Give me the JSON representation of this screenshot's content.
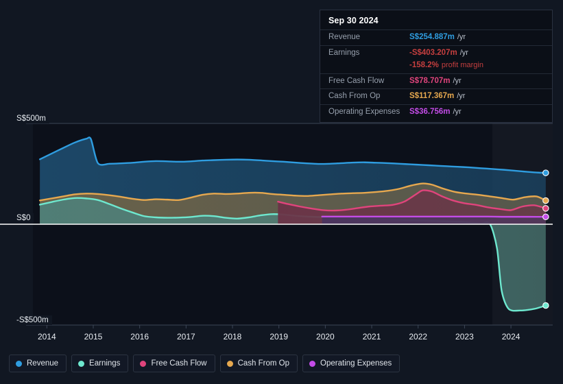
{
  "tooltip": {
    "date": "Sep 30 2024",
    "rows": [
      {
        "label": "Revenue",
        "value": "S$254.887m",
        "unit": "/yr",
        "color": "#2f9de0"
      },
      {
        "label": "Earnings",
        "value": "-S$403.207m",
        "unit": "/yr",
        "color": "#c63f3f"
      },
      {
        "label": "Free Cash Flow",
        "value": "S$78.707m",
        "unit": "/yr",
        "color": "#e0447c"
      },
      {
        "label": "Cash From Op",
        "value": "S$117.367m",
        "unit": "/yr",
        "color": "#e6a84f"
      },
      {
        "label": "Operating Expenses",
        "value": "S$36.756m",
        "unit": "/yr",
        "color": "#c44ce8"
      }
    ],
    "profit_margin": {
      "value": "-158.2%",
      "unit": "profit margin",
      "color": "#c63f3f"
    }
  },
  "legend": {
    "items": [
      {
        "label": "Revenue",
        "color": "#2f9de0"
      },
      {
        "label": "Earnings",
        "color": "#6ee8cf"
      },
      {
        "label": "Free Cash Flow",
        "color": "#e0447c"
      },
      {
        "label": "Cash From Op",
        "color": "#e6a84f"
      },
      {
        "label": "Operating Expenses",
        "color": "#c44ce8"
      }
    ]
  },
  "chart_data": {
    "type": "area",
    "title": "",
    "xlabel": "",
    "ylabel": "",
    "currency": "S$",
    "units": "millions",
    "xlim": [
      2013.7,
      2024.9
    ],
    "ylim": [
      -560,
      560
    ],
    "grid": true,
    "legend_position": "bottom",
    "y_ticks": [
      {
        "value": 500,
        "label": "S$500m"
      },
      {
        "value": 0,
        "label": "S$0"
      },
      {
        "value": -500,
        "label": "-S$500m"
      }
    ],
    "x_ticks": [
      {
        "value": 2014,
        "label": "2014"
      },
      {
        "value": 2015,
        "label": "2015"
      },
      {
        "value": 2016,
        "label": "2016"
      },
      {
        "value": 2017,
        "label": "2017"
      },
      {
        "value": 2018,
        "label": "2018"
      },
      {
        "value": 2019,
        "label": "2019"
      },
      {
        "value": 2020,
        "label": "2020"
      },
      {
        "value": 2021,
        "label": "2021"
      },
      {
        "value": 2022,
        "label": "2022"
      },
      {
        "value": 2023,
        "label": "2023"
      },
      {
        "value": 2024,
        "label": "2024"
      }
    ],
    "highlight_band": {
      "from": 2023.6,
      "to": 2024.9
    },
    "series": [
      {
        "name": "Revenue",
        "color": "#2f9de0",
        "fill": "#1d4a6b",
        "x": [
          2013.85,
          2014.1,
          2014.35,
          2014.6,
          2014.85,
          2014.95,
          2015.1,
          2015.35,
          2015.6,
          2015.85,
          2016.1,
          2016.35,
          2016.6,
          2016.85,
          2017.1,
          2017.35,
          2017.6,
          2017.85,
          2018.1,
          2018.35,
          2018.6,
          2018.85,
          2019.1,
          2019.35,
          2019.6,
          2019.85,
          2020.1,
          2020.35,
          2020.6,
          2020.85,
          2021.1,
          2021.35,
          2021.6,
          2021.85,
          2022.1,
          2022.35,
          2022.6,
          2022.85,
          2023.1,
          2023.35,
          2023.6,
          2023.85,
          2024.1,
          2024.35,
          2024.6,
          2024.75
        ],
        "y": [
          322,
          350,
          378,
          405,
          424,
          422,
          303,
          300,
          302,
          305,
          310,
          313,
          312,
          310,
          312,
          316,
          318,
          320,
          321,
          320,
          317,
          313,
          310,
          306,
          302,
          299,
          300,
          303,
          306,
          307,
          305,
          303,
          300,
          297,
          294,
          291,
          288,
          285,
          282,
          278,
          274,
          270,
          265,
          260,
          256,
          254.887
        ]
      },
      {
        "name": "Earnings",
        "color": "#6ee8cf",
        "fill": "#4f7f78",
        "x": [
          2013.85,
          2014.1,
          2014.35,
          2014.6,
          2014.85,
          2015.1,
          2015.35,
          2015.6,
          2015.85,
          2016.1,
          2016.35,
          2016.6,
          2016.85,
          2017.1,
          2017.35,
          2017.6,
          2017.85,
          2018.1,
          2018.35,
          2018.6,
          2018.85,
          2019.1,
          2019.35,
          2019.6,
          2019.85,
          2020.1,
          2020.35,
          2020.6,
          2020.85,
          2021.1,
          2021.35,
          2021.6,
          2021.85,
          2022.1,
          2022.35,
          2022.6,
          2022.85,
          2023.1,
          2023.35,
          2023.55,
          2023.7,
          2023.8,
          2023.95,
          2024.2,
          2024.5,
          2024.75
        ],
        "y": [
          97,
          110,
          122,
          130,
          128,
          120,
          100,
          78,
          58,
          40,
          34,
          32,
          33,
          36,
          42,
          40,
          32,
          28,
          34,
          44,
          50,
          48,
          42,
          38,
          36,
          34,
          32,
          30,
          28,
          26,
          24,
          22,
          20,
          18,
          16,
          14,
          12,
          8,
          4,
          0,
          -120,
          -330,
          -420,
          -428,
          -420,
          -403.207
        ]
      },
      {
        "name": "Free Cash Flow",
        "color": "#e0447c",
        "fill": "#6b3347",
        "x": [
          2018.98,
          2019.2,
          2019.45,
          2019.7,
          2019.95,
          2020.2,
          2020.45,
          2020.7,
          2020.95,
          2021.2,
          2021.45,
          2021.7,
          2021.95,
          2022.1,
          2022.3,
          2022.5,
          2022.75,
          2023.0,
          2023.25,
          2023.5,
          2023.75,
          2024.0,
          2024.25,
          2024.5,
          2024.75
        ],
        "y": [
          112,
          100,
          88,
          78,
          70,
          68,
          72,
          80,
          88,
          92,
          96,
          112,
          148,
          168,
          162,
          140,
          118,
          104,
          96,
          84,
          76,
          70,
          88,
          94,
          78.707
        ]
      },
      {
        "name": "Cash From Op",
        "color": "#e6a84f",
        "fill": "#6e6348",
        "x": [
          2013.85,
          2014.1,
          2014.35,
          2014.6,
          2014.85,
          2015.1,
          2015.35,
          2015.6,
          2015.85,
          2016.1,
          2016.35,
          2016.6,
          2016.85,
          2017.1,
          2017.35,
          2017.6,
          2017.85,
          2018.1,
          2018.35,
          2018.6,
          2018.85,
          2019.1,
          2019.35,
          2019.6,
          2019.85,
          2020.1,
          2020.35,
          2020.6,
          2020.85,
          2021.1,
          2021.35,
          2021.6,
          2021.85,
          2022.1,
          2022.3,
          2022.55,
          2022.8,
          2023.05,
          2023.3,
          2023.55,
          2023.8,
          2024.05,
          2024.3,
          2024.55,
          2024.75
        ],
        "y": [
          118,
          128,
          138,
          148,
          152,
          150,
          144,
          136,
          126,
          120,
          124,
          122,
          120,
          132,
          146,
          152,
          150,
          152,
          156,
          156,
          150,
          146,
          142,
          140,
          144,
          148,
          152,
          154,
          156,
          160,
          166,
          176,
          192,
          202,
          196,
          176,
          160,
          152,
          146,
          138,
          130,
          122,
          134,
          138,
          117.367
        ]
      },
      {
        "name": "Operating Expenses",
        "color": "#c44ce8",
        "fill": "#4a3560",
        "x": [
          2019.93,
          2020.2,
          2020.5,
          2020.8,
          2021.1,
          2021.4,
          2021.7,
          2022.0,
          2022.3,
          2022.6,
          2022.9,
          2023.2,
          2023.5,
          2023.8,
          2024.1,
          2024.4,
          2024.75
        ],
        "y": [
          38,
          38,
          38,
          38,
          38,
          38,
          38,
          38,
          38,
          38,
          38,
          38,
          38,
          37,
          37,
          37,
          36.756
        ]
      }
    ]
  }
}
